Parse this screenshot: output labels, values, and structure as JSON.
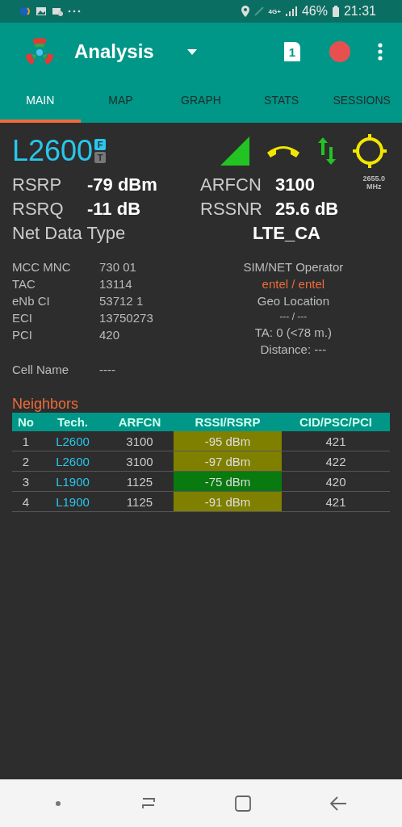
{
  "status_bar": {
    "network": "4G+",
    "battery": "46%",
    "time": "21:31"
  },
  "app_bar": {
    "title": "Analysis",
    "sim": "1"
  },
  "tabs": [
    {
      "label": "MAIN",
      "selected": true
    },
    {
      "label": "MAP",
      "selected": false
    },
    {
      "label": "GRAPH",
      "selected": false
    },
    {
      "label": "STATS",
      "selected": false
    },
    {
      "label": "SESSIONS",
      "selected": false
    }
  ],
  "serving": {
    "tech": "L2600",
    "badges": [
      "F",
      "T"
    ],
    "frequency": "2655.0",
    "frequency_unit": "MHz",
    "metrics": [
      {
        "label": "RSRP",
        "value": "-79 dBm"
      },
      {
        "label": "ARFCN",
        "value": "3100"
      },
      {
        "label": "RSRQ",
        "value": "-11 dB"
      },
      {
        "label": "RSSNR",
        "value": "25.6 dB"
      }
    ],
    "net_data_type": {
      "label": "Net Data Type",
      "value": "LTE_CA"
    }
  },
  "cell_info": [
    {
      "label": "MCC MNC",
      "value": "730 01"
    },
    {
      "label": "TAC",
      "value": "13114"
    },
    {
      "label": "eNb CI",
      "value": "53712 1"
    },
    {
      "label": "ECI",
      "value": "13750273"
    },
    {
      "label": "PCI",
      "value": "420"
    }
  ],
  "operator": {
    "title": "SIM/NET Operator",
    "value": "entel / entel",
    "geo_title": "Geo Location",
    "geo_value": "--- / ---",
    "ta": "TA: 0 (<78 m.)",
    "distance": "Distance: ---"
  },
  "cell_name": {
    "label": "Cell Name",
    "value": "----"
  },
  "neighbors": {
    "title": "Neighbors",
    "columns": [
      "No",
      "Tech.",
      "ARFCN",
      "RSSI/RSRP",
      "CID/PSC/PCI"
    ],
    "rows": [
      {
        "no": "1",
        "tech": "L2600",
        "arfcn": "3100",
        "signal": "-95 dBm",
        "color": "#808000",
        "id": "421"
      },
      {
        "no": "2",
        "tech": "L2600",
        "arfcn": "3100",
        "signal": "-97 dBm",
        "color": "#808000",
        "id": "422"
      },
      {
        "no": "3",
        "tech": "L1900",
        "arfcn": "1125",
        "signal": "-75 dBm",
        "color": "#087a10",
        "id": "420"
      },
      {
        "no": "4",
        "tech": "L1900",
        "arfcn": "1125",
        "signal": "-91 dBm",
        "color": "#808000",
        "id": "421"
      }
    ]
  }
}
